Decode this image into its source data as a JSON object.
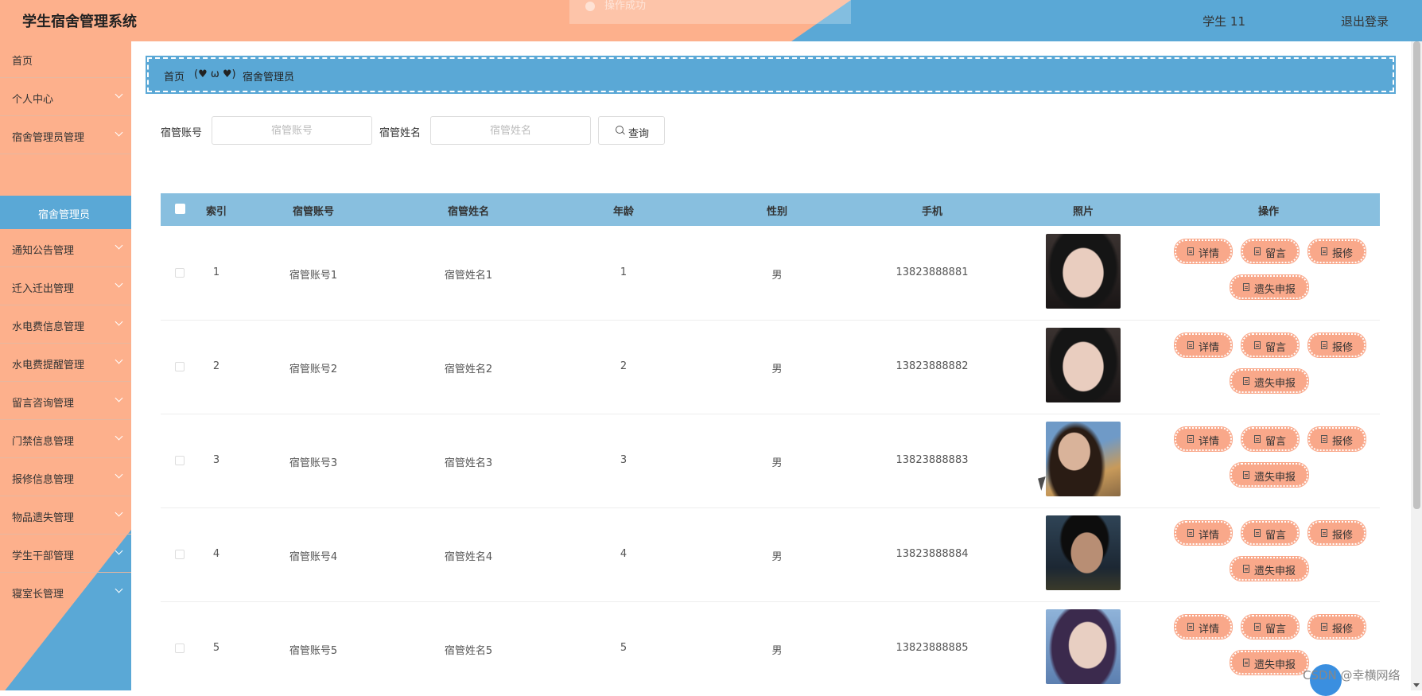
{
  "header": {
    "title": "学生宿舍管理系统",
    "toast": "操作成功",
    "user": "学生 11",
    "logout": "退出登录"
  },
  "sidebar": {
    "items": [
      {
        "label": "首页",
        "chevron": false
      },
      {
        "label": "个人中心",
        "chevron": true
      },
      {
        "label": "宿舍管理员管理",
        "chevron": true
      },
      {
        "label": "通知公告管理",
        "chevron": true
      },
      {
        "label": "迁入迁出管理",
        "chevron": true
      },
      {
        "label": "水电费信息管理",
        "chevron": true
      },
      {
        "label": "水电费提醒管理",
        "chevron": true
      },
      {
        "label": "留言咨询管理",
        "chevron": true
      },
      {
        "label": "门禁信息管理",
        "chevron": true
      },
      {
        "label": "报修信息管理",
        "chevron": true
      },
      {
        "label": "物品遗失管理",
        "chevron": true
      },
      {
        "label": "学生干部管理",
        "chevron": true
      },
      {
        "label": "寝室长管理",
        "chevron": true
      }
    ],
    "active_submenu": "宿舍管理员"
  },
  "breadcrumb": {
    "home": "首页",
    "separator": "(♥ ω ♥)",
    "current": "宿舍管理员"
  },
  "search": {
    "account_label": "宿管账号",
    "account_placeholder": "宿管账号",
    "name_label": "宿管姓名",
    "name_placeholder": "宿管姓名",
    "query_button": "查询"
  },
  "table": {
    "headers": [
      "索引",
      "宿管账号",
      "宿管姓名",
      "年龄",
      "性别",
      "手机",
      "照片",
      "操作"
    ],
    "rows": [
      {
        "index": "1",
        "account": "宿管账号1",
        "name": "宿管姓名1",
        "age": "1",
        "gender": "男",
        "phone": "13823888881"
      },
      {
        "index": "2",
        "account": "宿管账号2",
        "name": "宿管姓名2",
        "age": "2",
        "gender": "男",
        "phone": "13823888882"
      },
      {
        "index": "3",
        "account": "宿管账号3",
        "name": "宿管姓名3",
        "age": "3",
        "gender": "男",
        "phone": "13823888883"
      },
      {
        "index": "4",
        "account": "宿管账号4",
        "name": "宿管姓名4",
        "age": "4",
        "gender": "男",
        "phone": "13823888884"
      },
      {
        "index": "5",
        "account": "宿管账号5",
        "name": "宿管姓名5",
        "age": "5",
        "gender": "男",
        "phone": "13823888885"
      }
    ],
    "actions": {
      "detail": "详情",
      "message": "留言",
      "repair": "报修",
      "lost": "遗失申报"
    }
  },
  "watermark": "CSDN @幸横网络",
  "colors": {
    "salmon": "#fdb08c",
    "blue": "#5aa8d6",
    "header_row": "#88bfdf",
    "action_button": "#f9a88a"
  },
  "icons": {
    "search": "search-icon",
    "action": "document-icon",
    "chevron": "chevron-down-icon",
    "toast": "check-circle-icon"
  }
}
